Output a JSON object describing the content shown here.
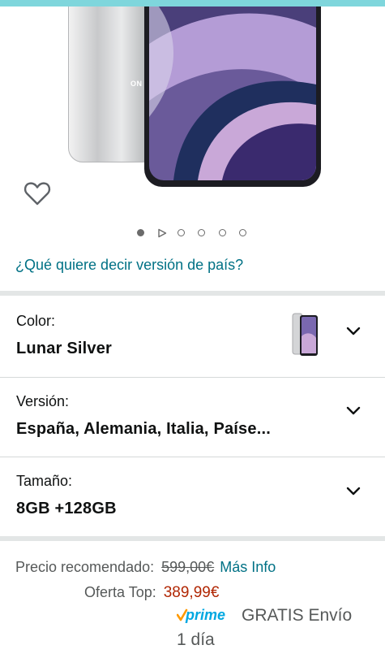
{
  "product_image": {
    "brand_mark": "ON",
    "wishlist_icon": "heart-outline-icon",
    "carousel": {
      "active_index": 0,
      "items": [
        "image",
        "video",
        "image",
        "image",
        "image",
        "image"
      ]
    }
  },
  "country_version_link": "¿Qué quiere decir versión de país?",
  "options": [
    {
      "label": "Color:",
      "value": "Lunar Silver",
      "icon": "chevron-down-icon"
    },
    {
      "label": "Versión:",
      "value": "España, Alemania, Italia, Paíse...",
      "icon": "chevron-down-icon"
    },
    {
      "label": "Tamaño:",
      "value": "8GB +128GB",
      "icon": "chevron-down-icon"
    }
  ],
  "pricing": {
    "recommended_label": "Precio recomendado:",
    "recommended_price": "599,00€",
    "more_info": "Más Info",
    "offer_label": "Oferta Top:",
    "offer_price": "389,99€",
    "prime_logo": "prime",
    "shipping": "GRATIS Envío",
    "shipping_time": "1 día"
  },
  "colors": {
    "link": "#007185",
    "price_red": "#b12704",
    "prime_blue": "#00a8e1",
    "prime_check": "#ff9900",
    "separator": "#e3e6e6",
    "top_bar": "#7fd6dc"
  }
}
